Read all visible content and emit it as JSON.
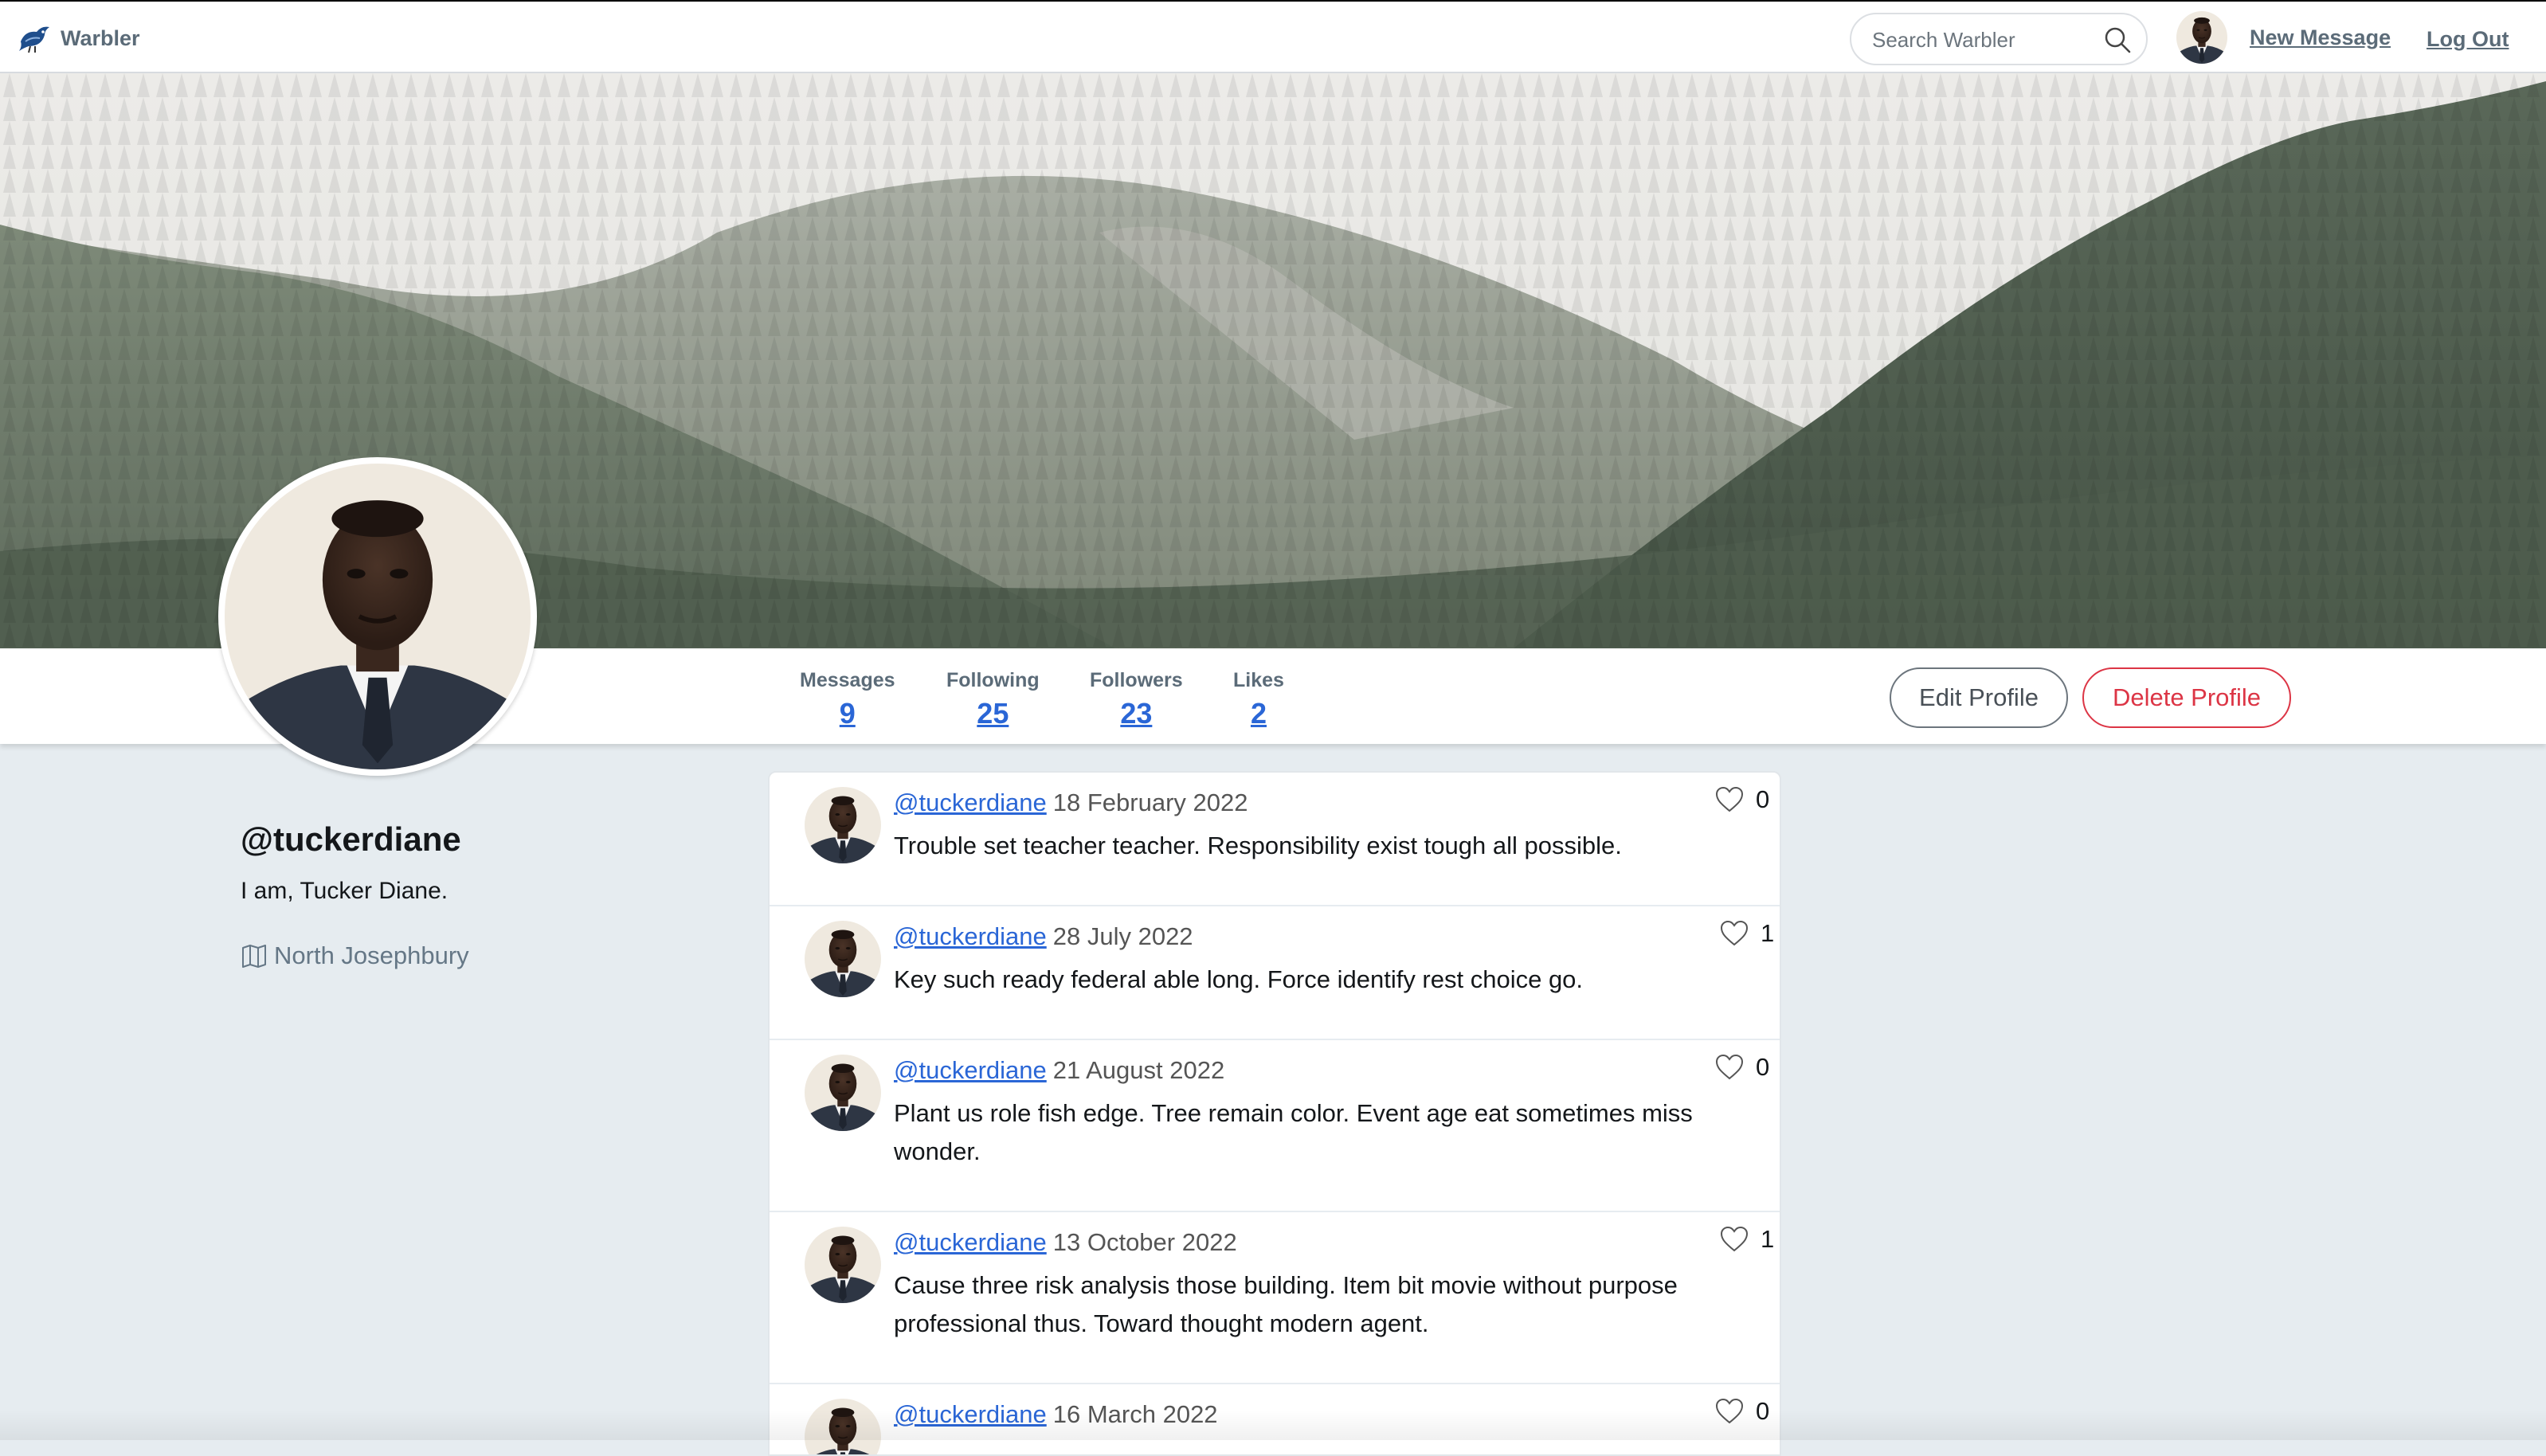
{
  "nav": {
    "brand": "Warbler",
    "search_placeholder": "Search Warbler",
    "new_message": "New Message",
    "logout": "Log Out"
  },
  "profile": {
    "username": "@tuckerdiane",
    "bio": "I am, Tucker Diane.",
    "location": "North Josephbury"
  },
  "stats": {
    "messages_label": "Messages",
    "messages": "9",
    "following_label": "Following",
    "following": "25",
    "followers_label": "Followers",
    "followers": "23",
    "likes_label": "Likes",
    "likes": "2"
  },
  "buttons": {
    "edit": "Edit Profile",
    "delete": "Delete Profile"
  },
  "messages": [
    {
      "user": "@tuckerdiane",
      "date": "18 February 2022",
      "text": "Trouble set teacher teacher. Responsibility exist tough all possible.",
      "likes": "0"
    },
    {
      "user": "@tuckerdiane",
      "date": "28 July 2022",
      "text": "Key such ready federal able long. Force identify rest choice go.",
      "likes": "1"
    },
    {
      "user": "@tuckerdiane",
      "date": "21 August 2022",
      "text": "Plant us role fish edge. Tree remain color. Event age eat sometimes miss wonder.",
      "likes": "0"
    },
    {
      "user": "@tuckerdiane",
      "date": "13 October 2022",
      "text": "Cause three risk analysis those building. Item bit movie without purpose professional thus. Toward thought modern agent.",
      "likes": "1"
    },
    {
      "user": "@tuckerdiane",
      "date": "16 March 2022",
      "text": "",
      "likes": "0"
    }
  ],
  "colors": {
    "accent_link": "#2a66d6",
    "danger": "#dc3545",
    "page_bg": "#e6ecf0"
  }
}
